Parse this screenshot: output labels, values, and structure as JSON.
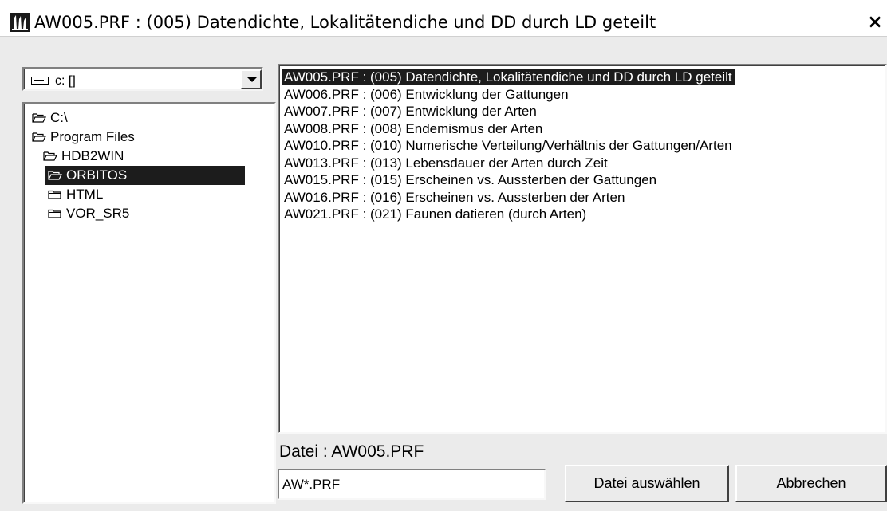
{
  "window": {
    "title": "AW005.PRF :  (005) Datendichte, Lokalitätendiche und DD durch LD geteilt",
    "app_icon": "hdb2win-app-icon",
    "close_label": "×"
  },
  "drive": {
    "selected": "c: []",
    "icon": "drive-icon"
  },
  "folder_tree": {
    "items": [
      {
        "label": "C:\\",
        "icon": "open-folder-icon",
        "selected": false
      },
      {
        "label": "Program Files",
        "icon": "open-folder-icon",
        "selected": false
      },
      {
        "label": "HDB2WIN",
        "icon": "open-folder-icon",
        "selected": false
      },
      {
        "label": "ORBITOS",
        "icon": "open-folder-icon",
        "selected": true
      },
      {
        "label": "HTML",
        "icon": "closed-folder-icon",
        "selected": false
      },
      {
        "label": "VOR_SR5",
        "icon": "closed-folder-icon",
        "selected": false
      }
    ]
  },
  "file_list": {
    "items": [
      {
        "label": "AW005.PRF :  (005) Datendichte, Lokalitätendiche und DD durch LD geteilt",
        "selected": true
      },
      {
        "label": "AW006.PRF :  (006) Entwicklung der Gattungen",
        "selected": false
      },
      {
        "label": "AW007.PRF :  (007) Entwicklung der Arten",
        "selected": false
      },
      {
        "label": "AW008.PRF :  (008) Endemismus der Arten",
        "selected": false
      },
      {
        "label": "AW010.PRF :  (010) Numerische Verteilung/Verhältnis der Gattungen/Arten",
        "selected": false
      },
      {
        "label": "AW013.PRF :  (013) Lebensdauer der Arten durch Zeit",
        "selected": false
      },
      {
        "label": "AW015.PRF :  (015) Erscheinen vs. Aussterben der Gattungen",
        "selected": false
      },
      {
        "label": "AW016.PRF :  (016) Erscheinen vs. Aussterben der Arten",
        "selected": false
      },
      {
        "label": "AW021.PRF :  (021) Faunen datieren (durch Arten)",
        "selected": false
      }
    ]
  },
  "file_label": "Datei : AW005.PRF",
  "filter": {
    "value": "AW*.PRF"
  },
  "buttons": {
    "select_label": "Datei auswählen",
    "cancel_label": "Abbrechen"
  }
}
